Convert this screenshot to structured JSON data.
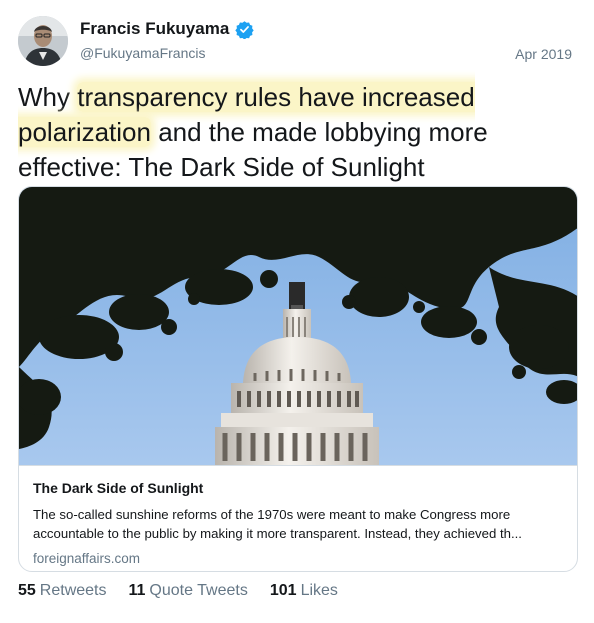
{
  "author": {
    "name": "Francis Fukuyama",
    "handle": "@FukuyamaFrancis",
    "verified_icon": "verified-badge-icon",
    "avatar": "avatar-photo"
  },
  "date": "Apr 2019",
  "tweet": {
    "text_parts": [
      "Why ",
      "transparency rules have increased polarization",
      " and the made lobbying more effective: The Dark Side of Sunlight"
    ]
  },
  "card": {
    "image": "capitol-dome-through-tree-branches",
    "title": "The Dark Side of Sunlight",
    "description": "The so-called sunshine reforms of the 1970s were meant to make Congress more accountable to the public by making it more transparent. Instead, they achieved th...",
    "domain": "foreignaffairs.com"
  },
  "stats": {
    "retweets_count": "55",
    "retweets_label": "Retweets",
    "quotes_count": "11",
    "quotes_label": "Quote Tweets",
    "likes_count": "101",
    "likes_label": "Likes"
  },
  "colors": {
    "verified": "#1da1f2",
    "highlight": "#fbf5c7",
    "secondary_text": "#657786",
    "sky": "#8db7e6"
  }
}
